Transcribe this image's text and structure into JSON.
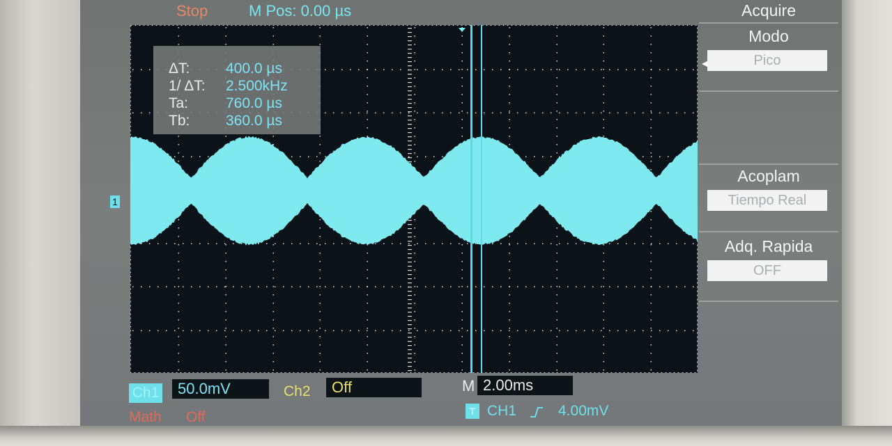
{
  "header": {
    "status": "Stop",
    "m_pos": "M Pos: 0.00 µs"
  },
  "cursors": {
    "rows": [
      {
        "label": "ΔT:",
        "value": "400.0 µs"
      },
      {
        "label": "1/ ΔT:",
        "value": "2.500kHz"
      },
      {
        "label": "Ta:",
        "value": "760.0 µs"
      },
      {
        "label": "Tb:",
        "value": "360.0 µs"
      }
    ]
  },
  "channel_marker": "1",
  "menu": {
    "title": "Acquire",
    "modo_label": "Modo",
    "modo_value": "Pico",
    "acoplam_label": "Acoplam",
    "acoplam_value": "Tiempo Real",
    "adq_label": "Adq. Rapida",
    "adq_value": "OFF"
  },
  "bottom": {
    "ch1_label": "Ch1",
    "ch1_scale": "50.0mV",
    "ch2_label": "Ch2",
    "ch2_value": "Off",
    "math_label": "Math",
    "math_value": "Off",
    "timebase_label": "M",
    "timebase_value": "2.00ms",
    "trigger_icon": "T",
    "trigger_source": "CH1",
    "trigger_edge": "rising-edge-icon",
    "trigger_level": "4.00mV"
  },
  "colors": {
    "trace": "#7fe9f0",
    "cursor": "#5cd8ea",
    "stop": "#e8866a",
    "ch2": "#e8e070",
    "math": "#e06a5a"
  }
}
